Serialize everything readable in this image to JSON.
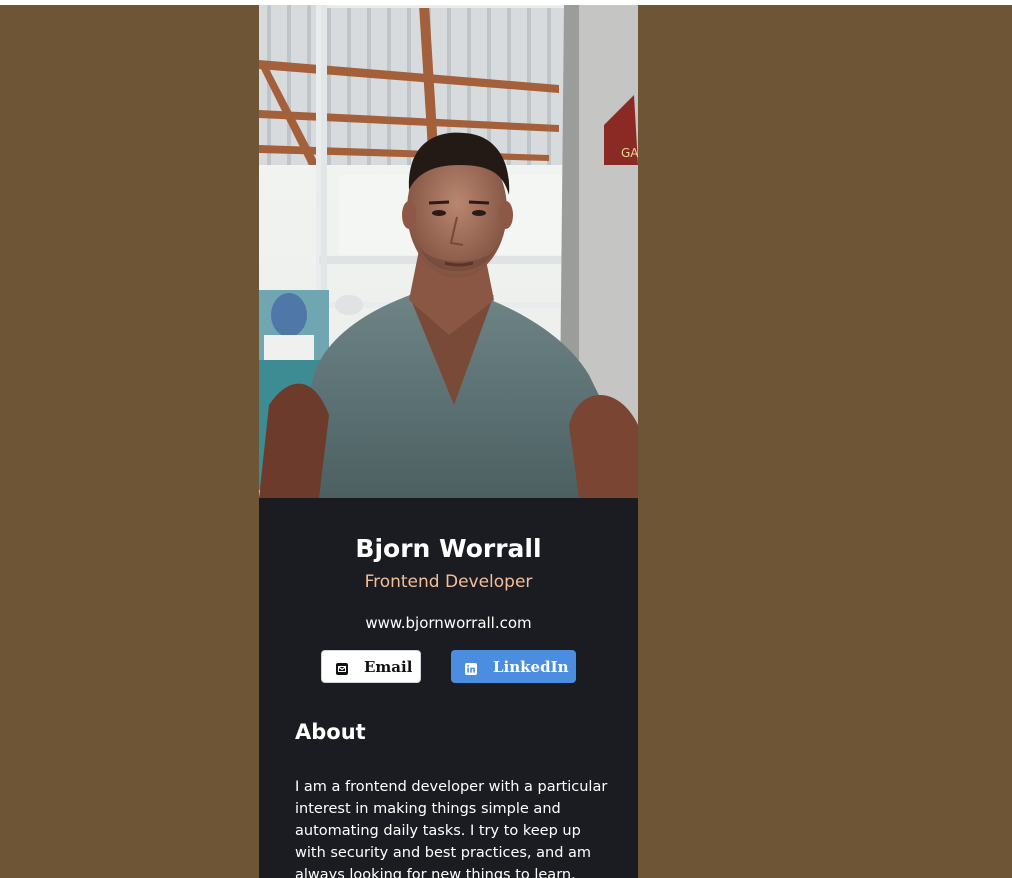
{
  "profile": {
    "name": "Bjorn Worrall",
    "role": "Frontend Developer",
    "website": "www.bjornworrall.com"
  },
  "buttons": {
    "email_label": "Email",
    "linkedin_label": "LinkedIn"
  },
  "about": {
    "title": "About",
    "text": "I am a frontend developer with a particular interest in making things simple and automating daily tasks. I try to keep up with security and best practices, and am always looking for new things to learn."
  },
  "icons": {
    "email": "envelope-icon",
    "linkedin": "linkedin-icon"
  },
  "colors": {
    "page_background": "#6d5536",
    "card_background": "#1b1c21",
    "role_accent": "#f3bf99",
    "linkedin_button": "#4b8ee0",
    "email_button": "#ffffff"
  }
}
